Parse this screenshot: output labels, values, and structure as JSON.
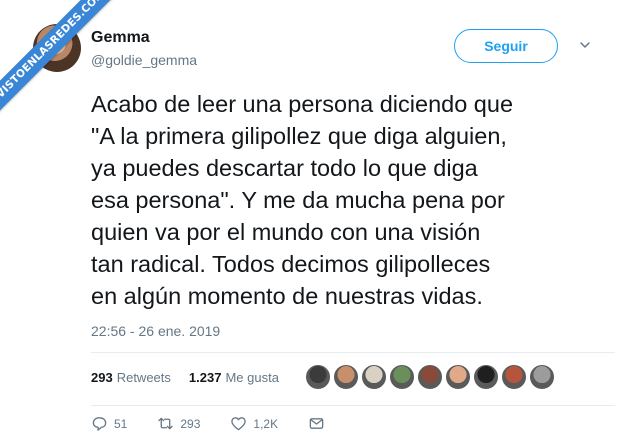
{
  "watermark": {
    "text": "VISTOENLASREDES.COM"
  },
  "user": {
    "name": "Gemma",
    "handle": "@goldie_gemma"
  },
  "follow": {
    "label": "Seguir"
  },
  "tweet": {
    "text": "Acabo de leer una persona diciendo que\n\"A la primera gilipollez que diga alguien,\nya puedes descartar todo lo que diga\nesa persona\". Y me da mucha pena por\nquien va por el mundo con una visión\ntan radical. Todos decimos gilipolleces\nen algún momento de nuestras vidas.",
    "timestamp": "22:56 - 26 ene. 2019"
  },
  "stats": {
    "retweets_count": "293",
    "retweets_label": "Retweets",
    "likes_count": "1.237",
    "likes_label": "Me gusta"
  },
  "likers": [
    {
      "color": "#3b3b3b"
    },
    {
      "color": "#c8906a"
    },
    {
      "color": "#d9d2c4"
    },
    {
      "color": "#6b8f5a"
    },
    {
      "color": "#8a4a3a"
    },
    {
      "color": "#e0a98a"
    },
    {
      "color": "#1f1f1f"
    },
    {
      "color": "#b5553d"
    },
    {
      "color": "#9c9c9c"
    }
  ],
  "actions": {
    "replies": "51",
    "retweets": "293",
    "likes": "1,2K"
  },
  "colors": {
    "accent": "#1da1f2",
    "text": "#14171a",
    "muted": "#657786",
    "ribbon": "#3a86d6"
  }
}
